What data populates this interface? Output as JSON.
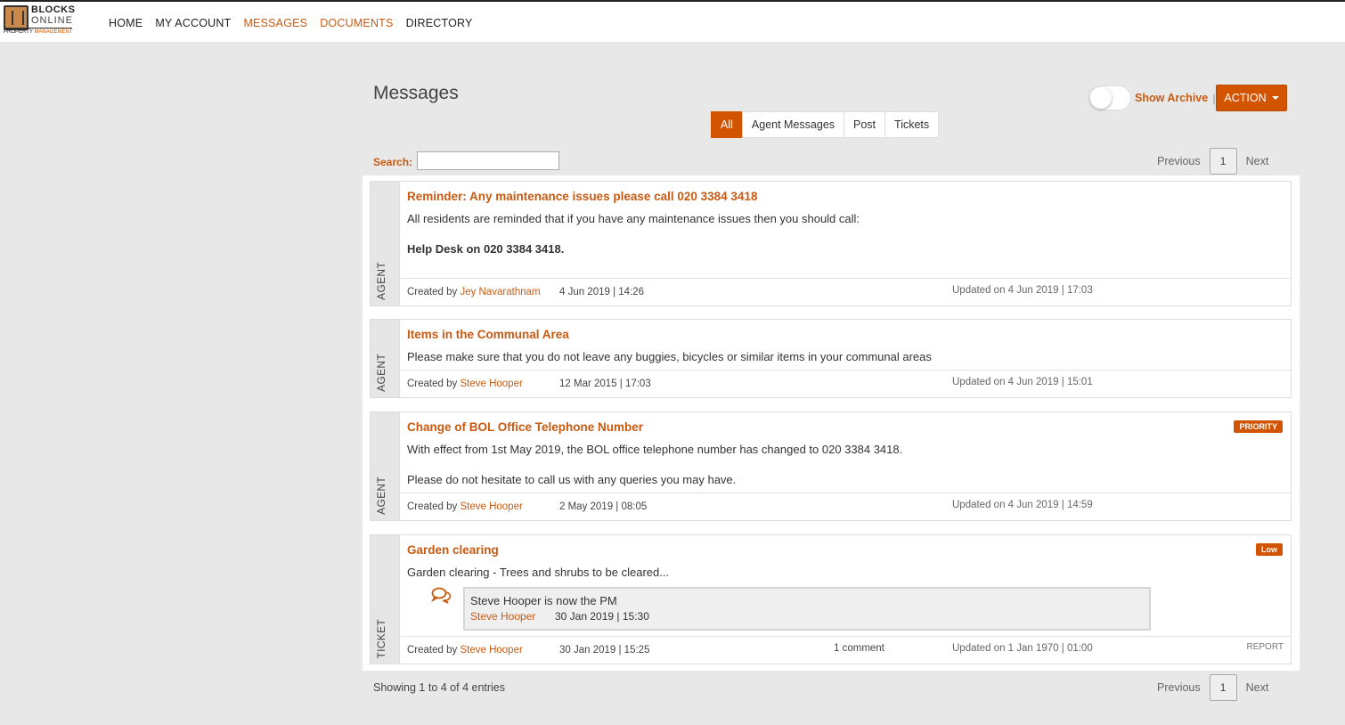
{
  "logo": {
    "line1": "BLOCKS",
    "line2": "ONLINE",
    "line3a": "PROPERTY",
    "line3b": "MANAGEMENT"
  },
  "nav": [
    "HOME",
    "MY ACCOUNT",
    "MESSAGES",
    "DOCUMENTS",
    "DIRECTORY"
  ],
  "page_title": "Messages",
  "archive_label": "Show Archive",
  "archive_sep": "|",
  "action_label": "ACTION",
  "filters": [
    "All",
    "Agent Messages",
    "Post",
    "Tickets"
  ],
  "search_label": "Search:",
  "search_value": "",
  "pager": {
    "prev": "Previous",
    "page": "1",
    "next": "Next"
  },
  "created_by_prefix": "Created by",
  "messages": [
    {
      "type": "AGENT",
      "title": "Reminder: Any maintenance issues please call 020 3384 3418",
      "body1": "All residents are reminded that if you have any maintenance issues then you should call:",
      "body2": "Help Desk on 020 3384 3418.",
      "author": "Jey Navarathnam",
      "date": "4 Jun 2019 | 14:26",
      "updated": "Updated on 4 Jun 2019 | 17:03"
    },
    {
      "type": "AGENT",
      "title": "Items in the Communal Area",
      "body1": "Please make sure that you do not leave any buggies, bicycles or similar items in your communal areas",
      "author": "Steve Hooper",
      "date": "12 Mar 2015 | 17:03",
      "updated": "Updated on 4 Jun 2019 | 15:01"
    },
    {
      "type": "AGENT",
      "badge": "PRIORITY",
      "title": "Change of BOL Office Telephone Number",
      "body1": "With effect from 1st May 2019, the BOL office telephone number has changed to 020 3384 3418.",
      "body2": "Please do not hesitate to call us with any queries you may have.",
      "author": "Steve Hooper",
      "date": "2 May 2019 | 08:05",
      "updated": "Updated on 4 Jun 2019 | 14:59"
    },
    {
      "type": "TICKET",
      "badge": "Low",
      "title": "Garden clearing",
      "body1": "Garden clearing - Trees and shrubs to be cleared...",
      "comment_text": "Steve Hooper is now the PM",
      "comment_author": "Steve Hooper",
      "comment_date": "30 Jan 2019 | 15:30",
      "author": "Steve Hooper",
      "date": "30 Jan 2019 | 15:25",
      "comments": "1 comment",
      "updated": "Updated on 1 Jan 1970 | 01:00",
      "report": "REPORT"
    }
  ],
  "showing": "Showing 1 to 4 of 4 entries",
  "colors": {
    "accent": "#d35400",
    "link": "#c85a12",
    "background": "#e8e8e8"
  }
}
